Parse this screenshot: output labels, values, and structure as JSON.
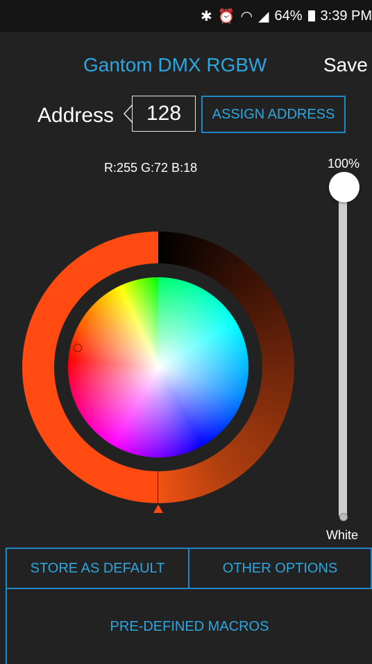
{
  "status_bar": {
    "battery": "64%",
    "time": "3:39 PM"
  },
  "header": {
    "title": "Gantom DMX RGBW",
    "save_label": "Save"
  },
  "address": {
    "label": "Address",
    "value": "128",
    "assign_label": "ASSIGN ADDRESS"
  },
  "color": {
    "rgb_text": "R:255 G:72 B:18",
    "hex": "#ff4812",
    "brightness": "100%",
    "white_label": "White"
  },
  "buttons": {
    "store_default": "STORE AS DEFAULT",
    "other_options": "OTHER OPTIONS",
    "macros": "PRE-DEFINED MACROS"
  },
  "accent": "#2ea6df"
}
